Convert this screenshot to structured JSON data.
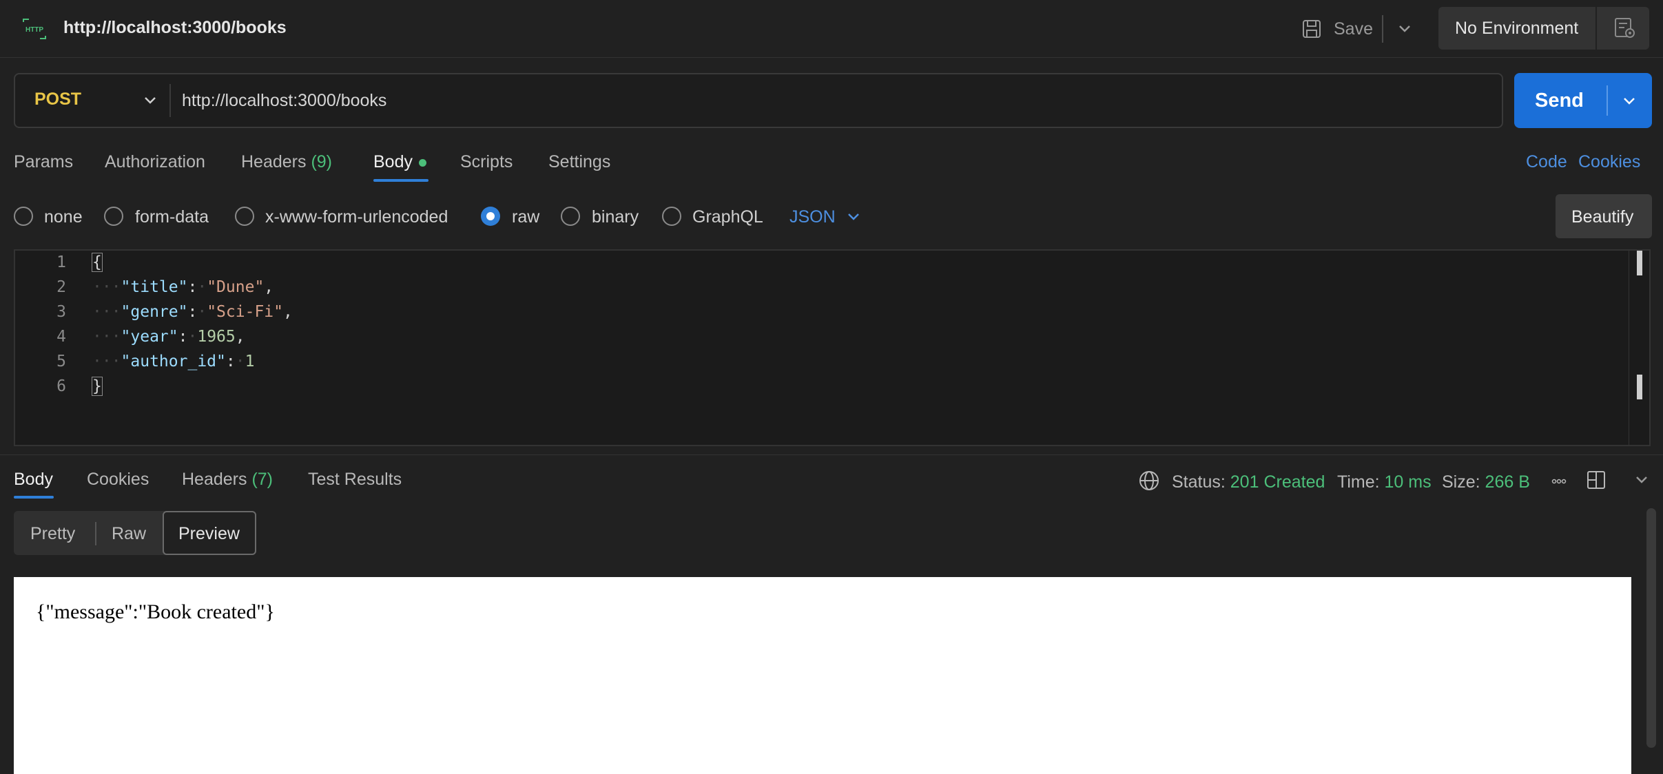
{
  "header": {
    "icon": "http-icon",
    "title": "http://localhost:3000/books",
    "save_label": "Save",
    "environment": "No Environment"
  },
  "request": {
    "method": "POST",
    "url": "http://localhost:3000/books",
    "send_label": "Send"
  },
  "tabs": {
    "params": "Params",
    "authorization": "Authorization",
    "headers": "Headers",
    "headers_count": "(9)",
    "body": "Body",
    "scripts": "Scripts",
    "settings": "Settings",
    "code_link": "Code",
    "cookies_link": "Cookies"
  },
  "body_types": {
    "none": "none",
    "form_data": "form-data",
    "urlencoded": "x-www-form-urlencoded",
    "raw": "raw",
    "binary": "binary",
    "graphql": "GraphQL",
    "selected": "raw",
    "format": "JSON",
    "beautify": "Beautify"
  },
  "editor": {
    "line_numbers": [
      "1",
      "2",
      "3",
      "4",
      "5",
      "6"
    ],
    "open_brace": "{",
    "close_brace": "}",
    "k_title": "\"title\"",
    "v_title": "\"Dune\"",
    "k_genre": "\"genre\"",
    "v_genre": "\"Sci-Fi\"",
    "k_year": "\"year\"",
    "v_year": "1965",
    "k_author": "\"author_id\"",
    "v_author": "1"
  },
  "response": {
    "tabs": {
      "body": "Body",
      "cookies": "Cookies",
      "headers": "Headers",
      "headers_count": "(7)",
      "test_results": "Test Results"
    },
    "status_label": "Status:",
    "status_value": "201 Created",
    "time_label": "Time:",
    "time_value": "10 ms",
    "size_label": "Size:",
    "size_value": "266 B",
    "views": {
      "pretty": "Pretty",
      "raw": "Raw",
      "preview": "Preview",
      "selected": "Preview"
    },
    "preview_text": "{\"message\":\"Book created\"}"
  },
  "colors": {
    "accent_blue": "#1b6fd8",
    "success_green": "#4cbf7a",
    "method_post": "#e8c547"
  }
}
